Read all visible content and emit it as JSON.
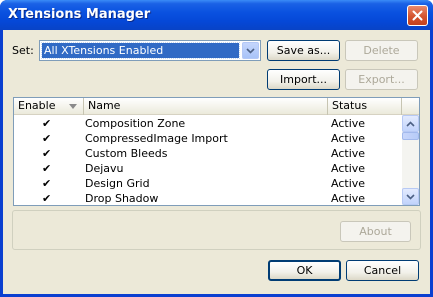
{
  "window": {
    "title": "XTensions Manager"
  },
  "set": {
    "label": "Set:",
    "selected": "All XTensions Enabled"
  },
  "buttons": {
    "save_as": "Save as...",
    "delete": "Delete",
    "import": "Import...",
    "export": "Export...",
    "about": "About",
    "ok": "OK",
    "cancel": "Cancel"
  },
  "list": {
    "columns": {
      "enable": "Enable",
      "name": "Name",
      "status": "Status"
    },
    "rows": [
      {
        "enabled": "✔",
        "name": "Composition Zone",
        "status": "Active"
      },
      {
        "enabled": "✔",
        "name": "CompressedImage Import",
        "status": "Active"
      },
      {
        "enabled": "✔",
        "name": "Custom Bleeds",
        "status": "Active"
      },
      {
        "enabled": "✔",
        "name": "Dejavu",
        "status": "Active"
      },
      {
        "enabled": "✔",
        "name": "Design Grid",
        "status": "Active"
      },
      {
        "enabled": "✔",
        "name": "Drop Shadow",
        "status": "Active"
      }
    ]
  },
  "colors": {
    "title_bar": "#0a52e0",
    "dialog_bg": "#ece9d8",
    "selection": "#316ac5"
  },
  "icons": {
    "close": "close-icon",
    "dropdown": "chevron-down-icon",
    "sort": "sort-down-icon",
    "scroll_up": "chevron-up-icon",
    "scroll_down": "chevron-down-icon"
  }
}
